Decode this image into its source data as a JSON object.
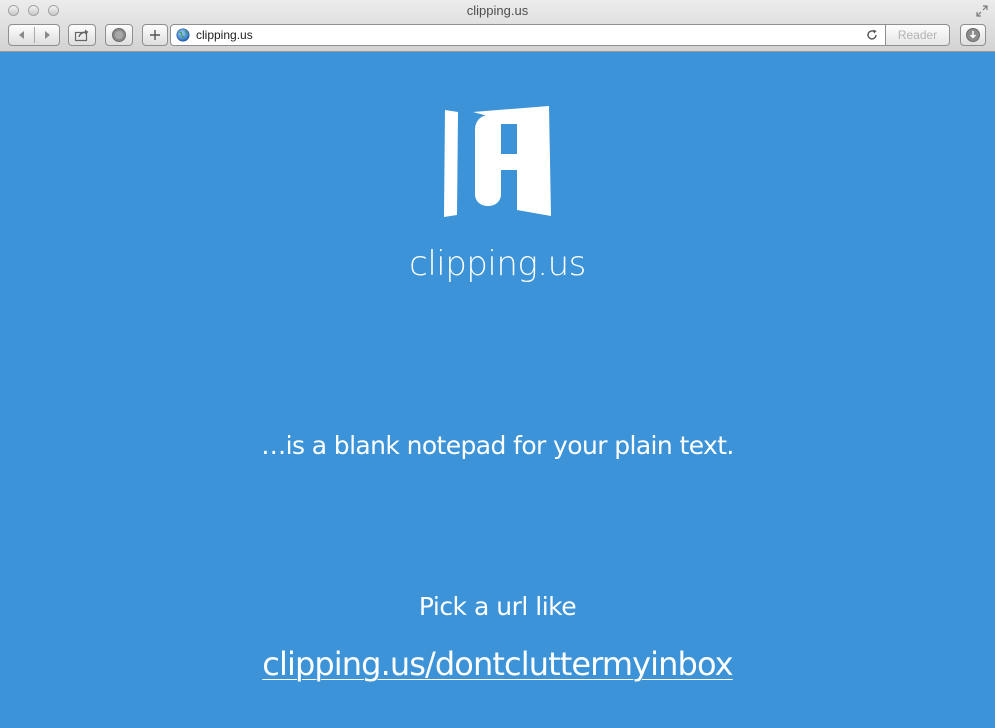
{
  "browser": {
    "window_title": "clipping.us",
    "address_bar": {
      "url": "clipping.us"
    },
    "reader_label": "Reader",
    "icons": {
      "back": "chevron-left-icon",
      "forward": "chevron-right-icon",
      "share": "share-icon",
      "history": "history-icon",
      "add": "plus-icon",
      "globe": "globe-icon",
      "reload": "reload-icon",
      "downloads": "download-icon",
      "fullscreen": "fullscreen-icon"
    }
  },
  "page": {
    "background_color": "#3c93d8",
    "text_color": "#ffffff",
    "logo_icon": "clipping-logo-icon",
    "site_name": "clipping.us",
    "tagline": "…is a blank notepad for your plain text.",
    "pick_label": "Pick a url like",
    "example_link": "clipping.us/dontcluttermyinbox"
  }
}
